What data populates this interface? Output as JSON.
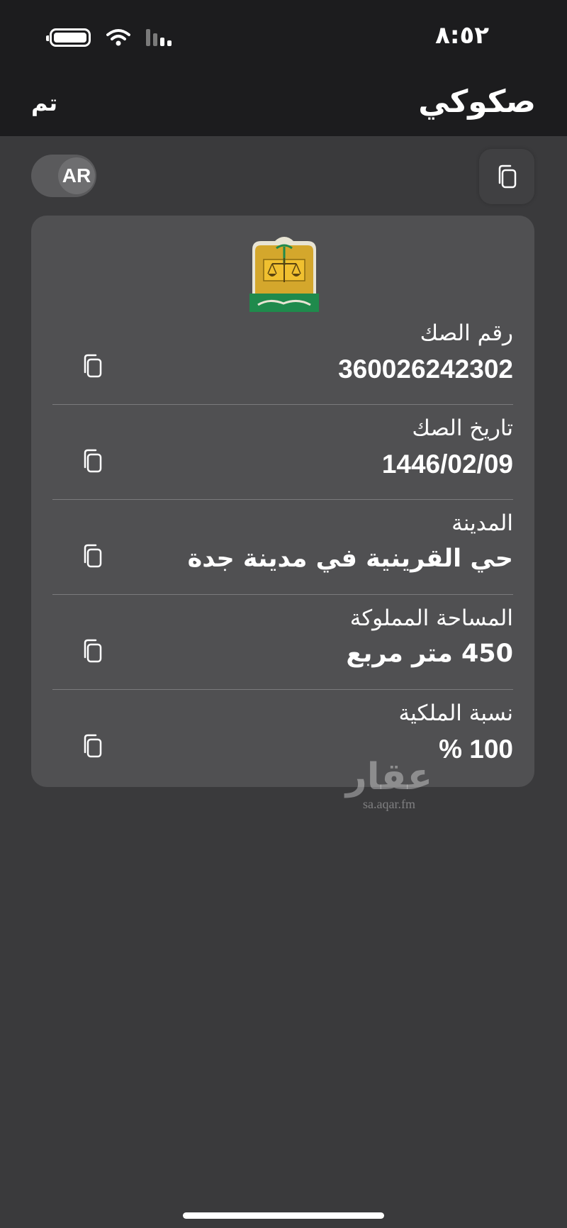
{
  "status_bar": {
    "time": "٨:٥٢",
    "icons": [
      "battery-icon",
      "wifi-icon",
      "cellular-signal-icon"
    ]
  },
  "nav": {
    "title": "صكوكي",
    "done_label": "تم"
  },
  "toolbar": {
    "lang_toggle_label": "AR",
    "copy_all_icon": "copy-icon"
  },
  "card": {
    "emblem_name": "ministry-of-justice-emblem",
    "emblem_text": "وزارة العدل",
    "fields": [
      {
        "label": "رقم الصك",
        "value": "360026242302"
      },
      {
        "label": "تاريخ الصك",
        "value": "1446/02/09"
      },
      {
        "label": "المدينة",
        "value": "حي القرينية في  مدينة جدة"
      },
      {
        "label": "المساحة المملوكة",
        "value": "450 متر مربع"
      },
      {
        "label": "نسبة الملكية",
        "value": "100 %"
      }
    ]
  },
  "watermark": {
    "text": "عقار",
    "url": "sa.aqar.fm"
  },
  "colors": {
    "background": "#3a3a3c",
    "header": "#1c1c1e",
    "card": "#505052",
    "emblem_gold": "#d4a72c",
    "emblem_green": "#1f8a4c"
  }
}
